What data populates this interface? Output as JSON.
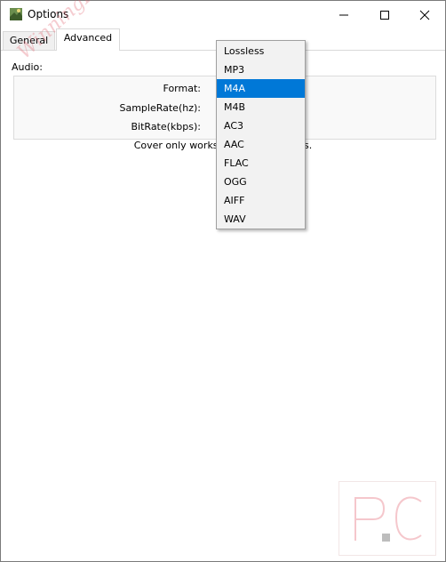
{
  "window": {
    "title": "Options",
    "controls": [
      "minimize-icon",
      "maximize-icon",
      "close-icon"
    ]
  },
  "tabs": [
    {
      "label": "General",
      "active": false
    },
    {
      "label": "Advanced",
      "active": true
    }
  ],
  "audio": {
    "section_label": "Audio:",
    "format_label": "Format:",
    "samplerate_label": "SampleRate(hz):",
    "bitrate_label": "BitRate(kbps):",
    "note_visible_start": "Cover only works w",
    "note_visible_end": "s."
  },
  "format_dropdown": {
    "options": [
      "Lossless",
      "MP3",
      "M4A",
      "M4B",
      "AC3",
      "AAC",
      "FLAC",
      "OGG",
      "AIFF",
      "WAV"
    ],
    "selected": "M4A"
  },
  "watermark": {
    "text": "WinningPC",
    "logo_text": "P.C"
  },
  "colors": {
    "selection": "#0078d7",
    "dropdown_bg": "#f2f2f2",
    "watermark": "#e06e78"
  }
}
